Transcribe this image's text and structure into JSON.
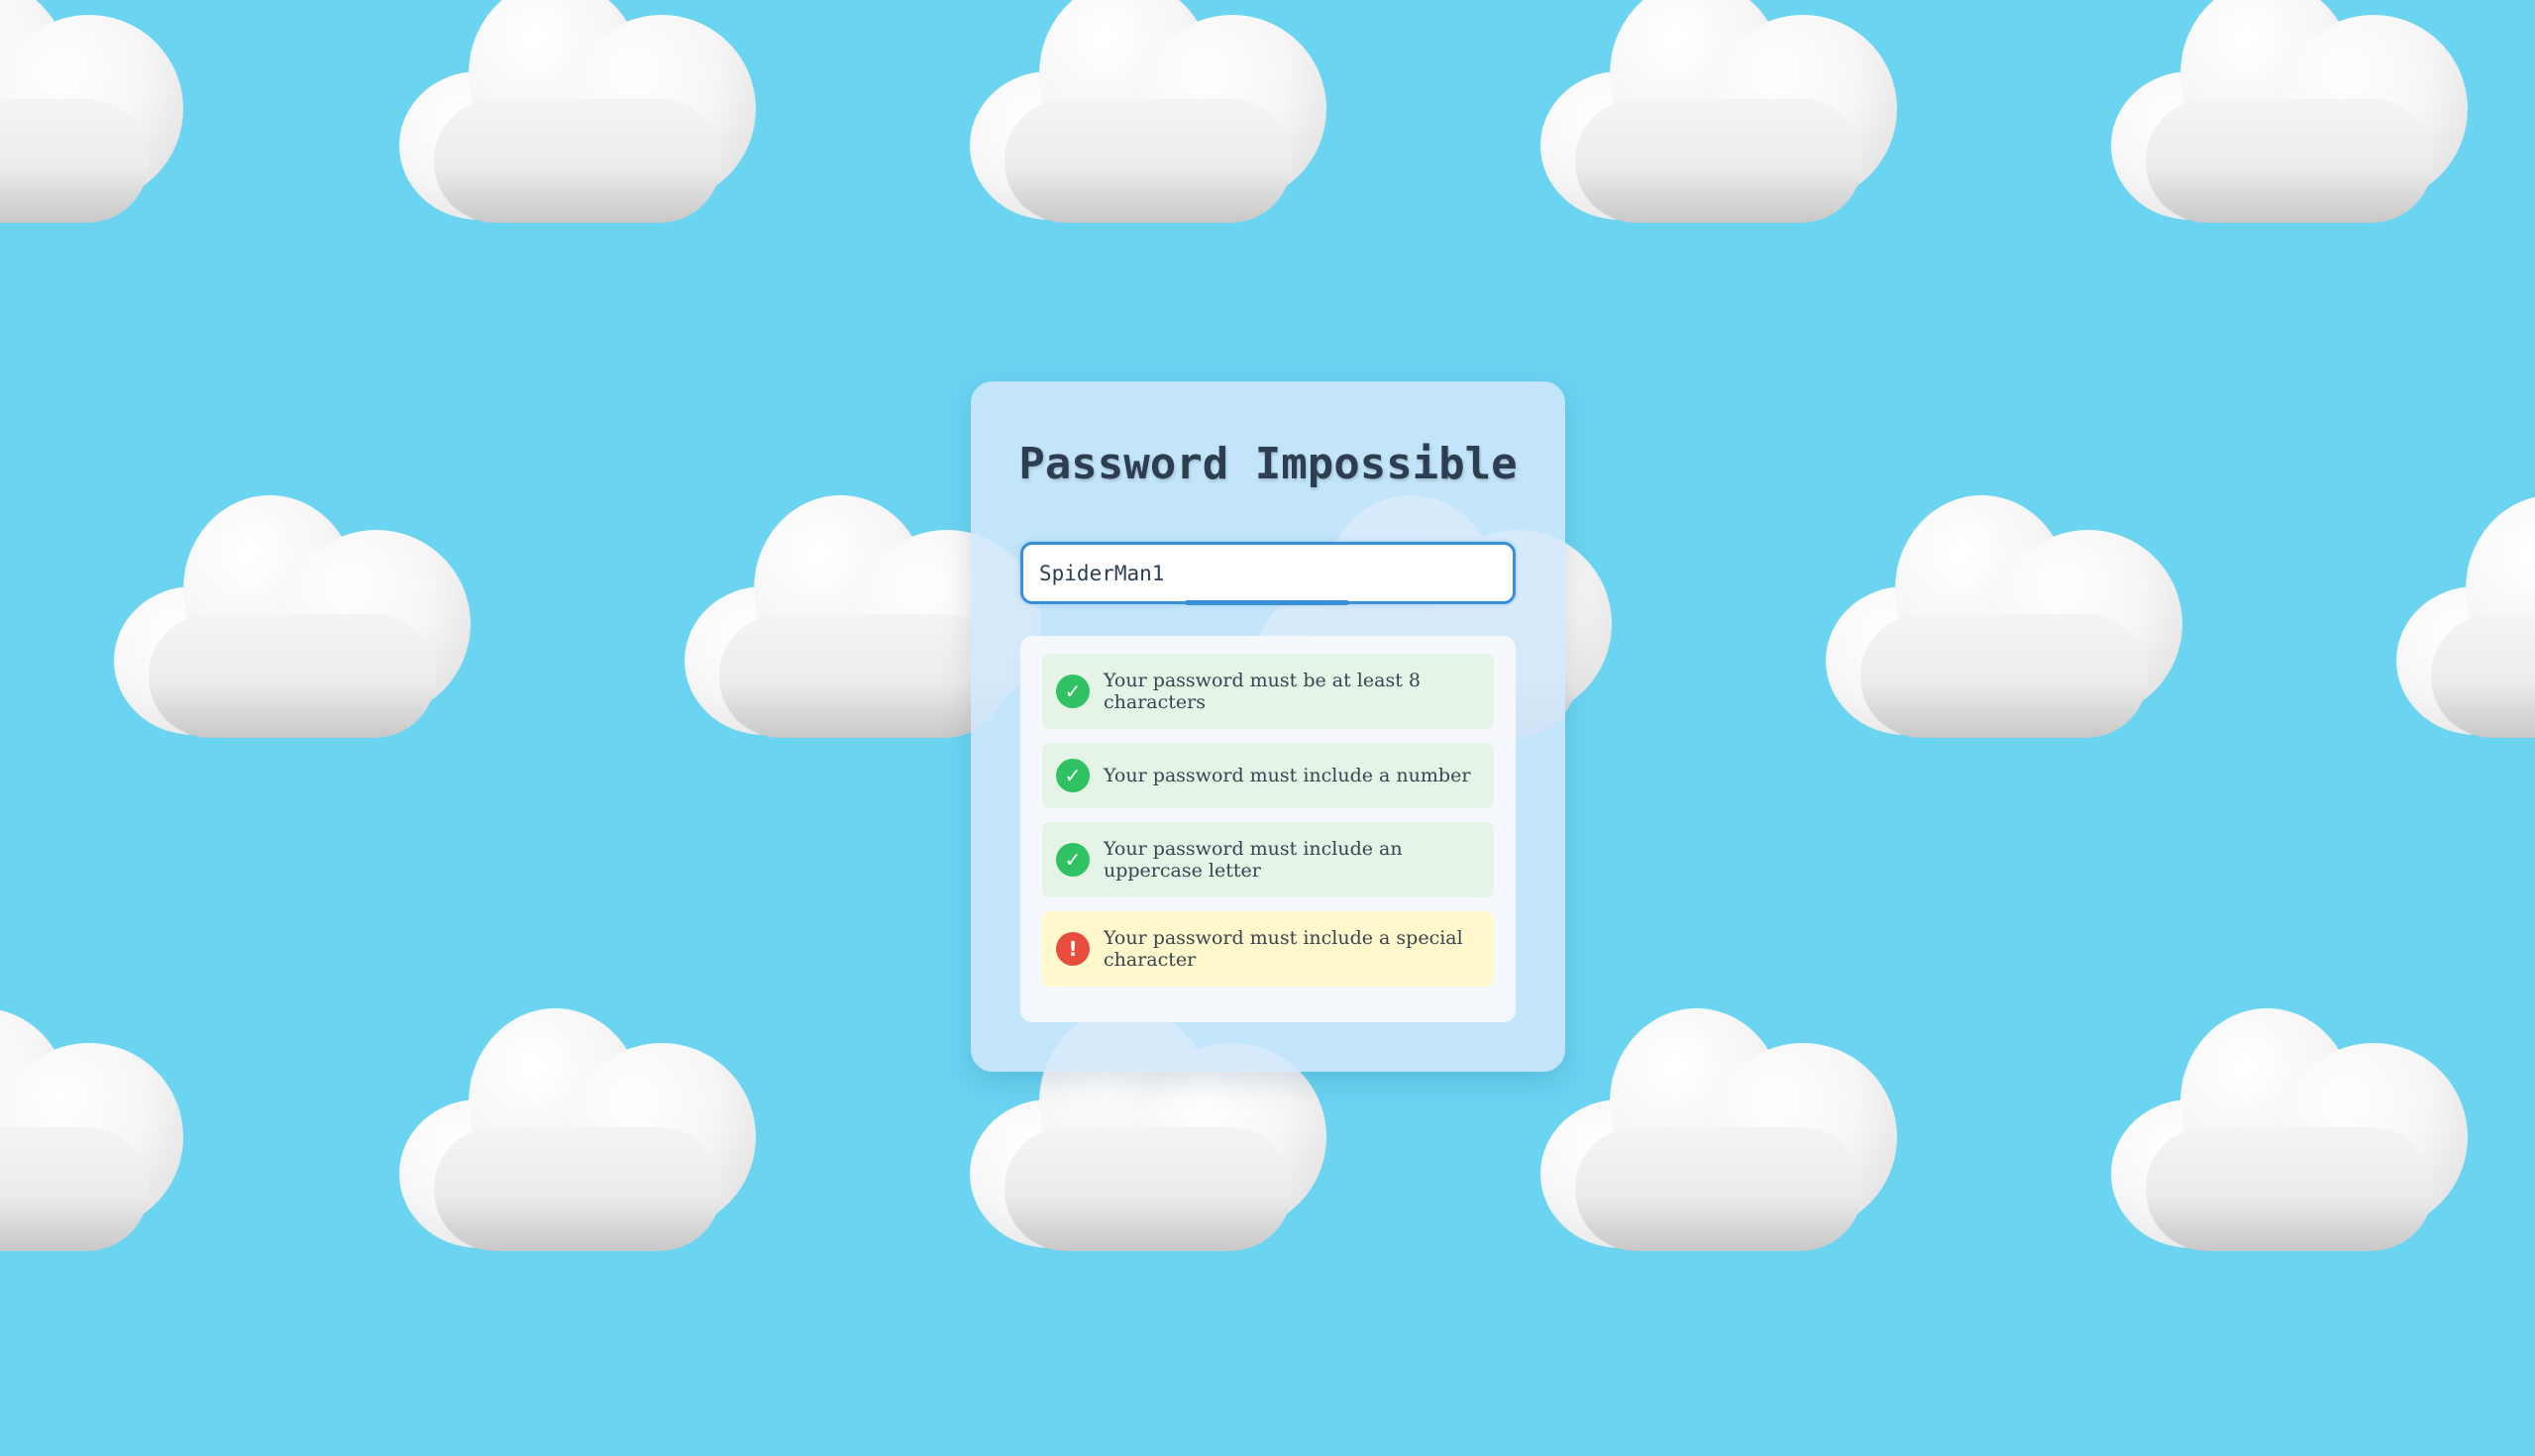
{
  "app": {
    "title": "Password Impossible"
  },
  "password_field": {
    "value": "SpiderMan1",
    "strength_fraction": 0.33
  },
  "rules": [
    {
      "text": "Your password must be at least 8 characters",
      "status": "pass",
      "icon": "check-icon",
      "glyph": "✓"
    },
    {
      "text": "Your password must include a number",
      "status": "pass",
      "icon": "check-icon",
      "glyph": "✓"
    },
    {
      "text": "Your password must include an uppercase letter",
      "status": "pass",
      "icon": "check-icon",
      "glyph": "✓"
    },
    {
      "text": "Your password must include a special character",
      "status": "fail",
      "icon": "error-icon",
      "glyph": "!"
    }
  ],
  "colors": {
    "background": "#6ad4f1",
    "accent": "#3a8fd9",
    "pass": "#2fc162",
    "fail": "#e74c3c",
    "pass_bg": "#e6f3e7",
    "fail_bg": "#fef8cc"
  }
}
